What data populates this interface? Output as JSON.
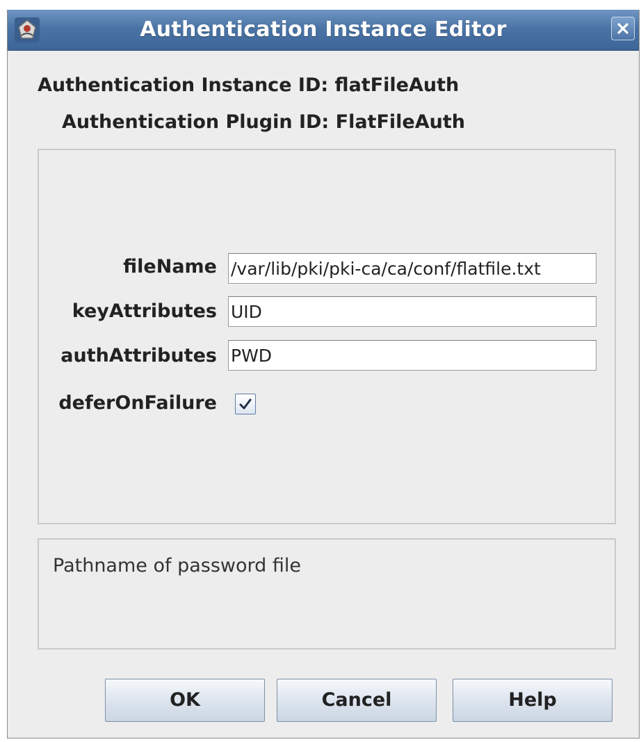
{
  "window": {
    "title": "Authentication Instance Editor",
    "app_icon": "java-duke-icon",
    "close_icon": "close-icon"
  },
  "info": {
    "instance_id_line": "Authentication Instance ID: flatFileAuth",
    "plugin_id_line": "Authentication Plugin ID: FlatFileAuth"
  },
  "form": {
    "fileName": {
      "label": "fileName",
      "value": "/var/lib/pki/pki-ca/ca/conf/flatfile.txt"
    },
    "keyAttributes": {
      "label": "keyAttributes",
      "value": "UID"
    },
    "authAttributes": {
      "label": "authAttributes",
      "value": "PWD"
    },
    "deferOnFailure": {
      "label": "deferOnFailure",
      "checked": true
    }
  },
  "description": {
    "text": "Pathname of password file"
  },
  "buttons": {
    "ok": "OK",
    "cancel": "Cancel",
    "help": "Help"
  },
  "colors": {
    "titlebar": "#4b74a6",
    "background": "#ededed"
  }
}
